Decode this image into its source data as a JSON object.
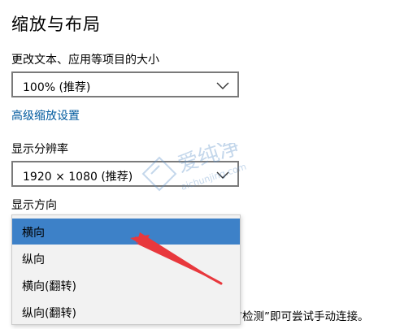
{
  "page": {
    "title": "缩放与布局"
  },
  "scale": {
    "label": "更改文本、应用等项目的大小",
    "selected": "100% (推荐)",
    "advanced_link": "高级缩放设置"
  },
  "resolution": {
    "label": "显示分辨率",
    "selected": "1920 × 1080 (推荐)"
  },
  "orientation": {
    "label": "显示方向",
    "options": [
      "横向",
      "纵向",
      "横向(翻转)",
      "纵向(翻转)"
    ],
    "selected_index": 0
  },
  "footnote": "“检测”即可尝试手动连接。",
  "watermark": {
    "text": "爱纯净",
    "subtext": "aichunjing.com"
  },
  "colors": {
    "accent": "#3d81c8",
    "link": "#005a9e",
    "arrow": "#e8383d"
  }
}
